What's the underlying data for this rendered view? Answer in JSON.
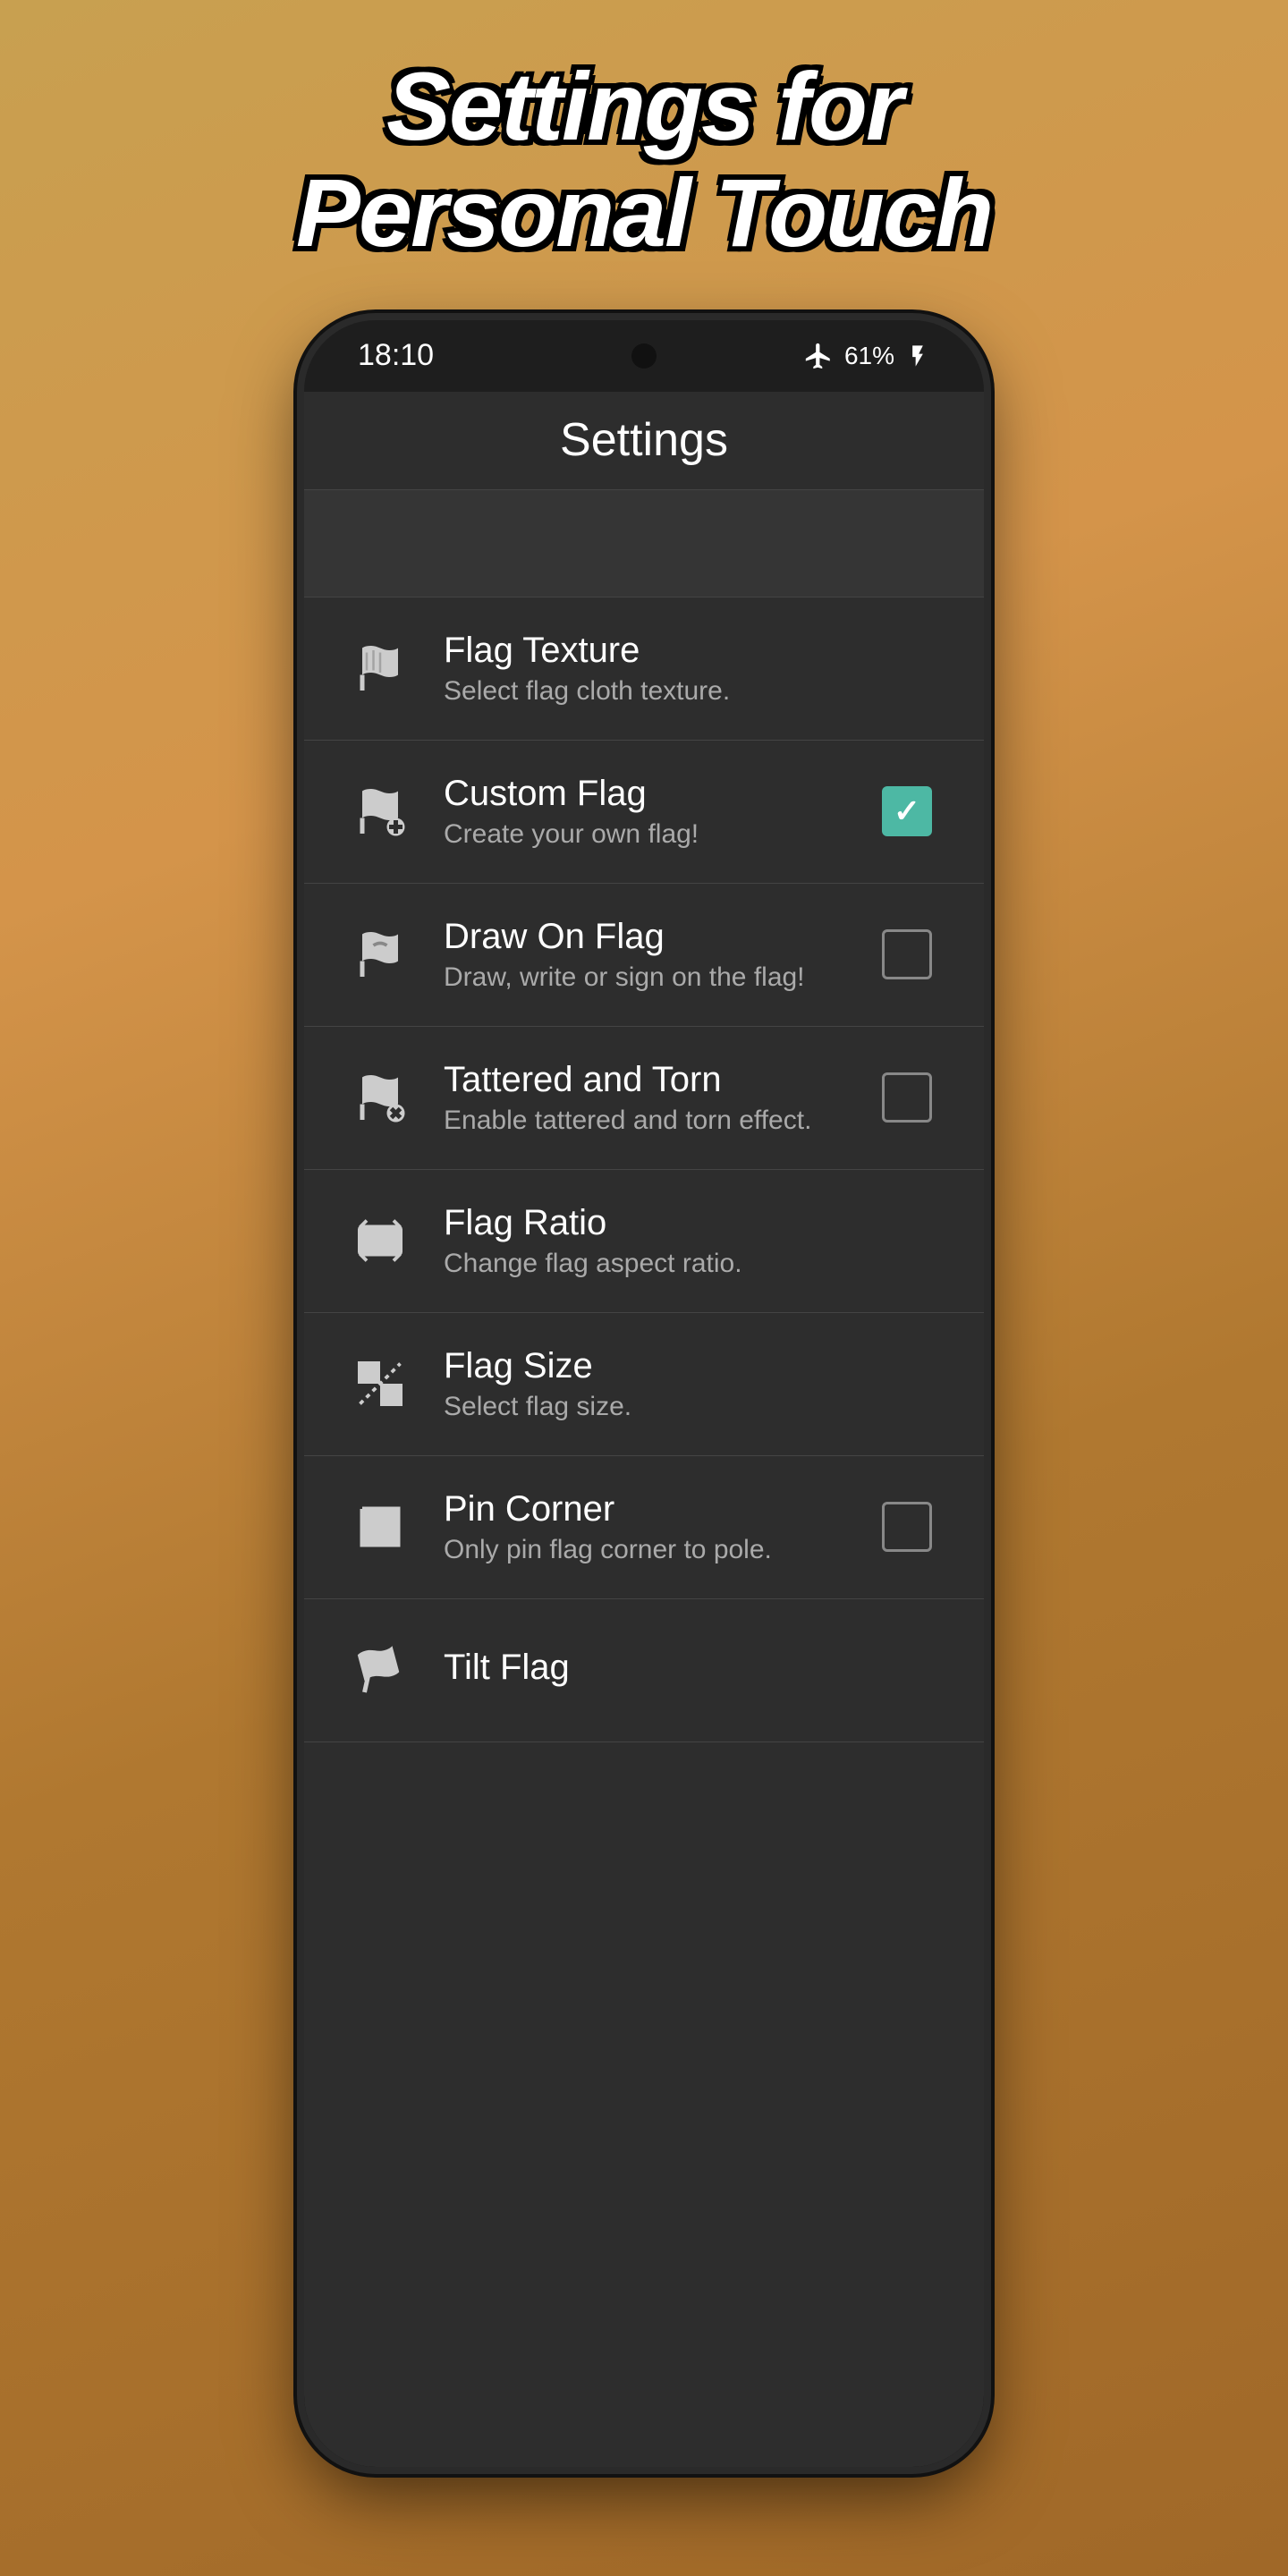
{
  "page": {
    "title_line1": "Settings for",
    "title_line2": "Personal Touch"
  },
  "status_bar": {
    "time": "18:10",
    "battery": "61%"
  },
  "header": {
    "title": "Settings"
  },
  "settings_items": [
    {
      "id": "flag-texture",
      "title": "Flag Texture",
      "subtitle": "Select flag cloth texture.",
      "icon": "flag-texture-icon",
      "control": "none"
    },
    {
      "id": "custom-flag",
      "title": "Custom Flag",
      "subtitle": "Create your own flag!",
      "icon": "custom-flag-icon",
      "control": "checkbox-checked"
    },
    {
      "id": "draw-on-flag",
      "title": "Draw On Flag",
      "subtitle": "Draw, write or sign on the flag!",
      "icon": "draw-flag-icon",
      "control": "checkbox-unchecked"
    },
    {
      "id": "tattered-torn",
      "title": "Tattered and Torn",
      "subtitle": "Enable tattered and torn effect.",
      "icon": "tattered-flag-icon",
      "control": "checkbox-unchecked"
    },
    {
      "id": "flag-ratio",
      "title": "Flag Ratio",
      "subtitle": "Change flag aspect ratio.",
      "icon": "flag-ratio-icon",
      "control": "none"
    },
    {
      "id": "flag-size",
      "title": "Flag Size",
      "subtitle": "Select flag size.",
      "icon": "flag-size-icon",
      "control": "none"
    },
    {
      "id": "pin-corner",
      "title": "Pin Corner",
      "subtitle": "Only pin flag corner to pole.",
      "icon": "pin-corner-icon",
      "control": "checkbox-unchecked"
    },
    {
      "id": "tilt-flag",
      "title": "Tilt Flag",
      "subtitle": "",
      "icon": "tilt-flag-icon",
      "control": "none"
    }
  ]
}
